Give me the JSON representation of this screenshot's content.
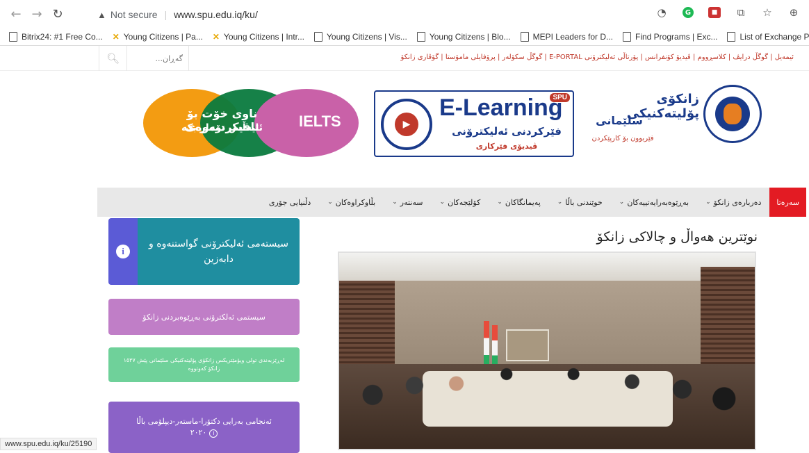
{
  "browser": {
    "insecure_label": "Not secure",
    "url": "www.spu.edu.iq/ku/",
    "bookmarks": [
      {
        "label": "Bitrix24: #1 Free Co...",
        "icon": "page-icon"
      },
      {
        "label": "Young Citizens | Pa...",
        "icon": "x-logo-icon"
      },
      {
        "label": "Young Citizens | Intr...",
        "icon": "x-logo-icon"
      },
      {
        "label": "Young Citizens | Vis...",
        "icon": "page-icon"
      },
      {
        "label": "Young Citizens | Blo...",
        "icon": "page-icon"
      },
      {
        "label": "MEPI Leaders for D...",
        "icon": "page-icon"
      },
      {
        "label": "Find Programs | Exc...",
        "icon": "page-icon"
      },
      {
        "label": "List of Exchange Pr...",
        "icon": "page-icon"
      }
    ],
    "status_url": "www.spu.edu.iq/ku/25190"
  },
  "topstrip": {
    "search_placeholder": "گەڕان...",
    "links": "ئیمەیل | گوگڵ درایڤ | کلاسڕووم | ڤیدیۆ کۆنفرانس | پۆرتاڵی ئەلیکترۆنی E-PORTAL | گوگڵ سکۆلەر | پرۆفایلی مامۆستا | گۆڤاری زانکۆ"
  },
  "banner": {
    "ielts_main": "ناوی خۆت بۆ تاقیکردنەوەی",
    "ielts_sub": "ئایەڵس تۆمار بکە",
    "ielts_word": "IELTS",
    "elearn_title": "E-Learning",
    "elearn_badge": "SPU",
    "elearn_sub": "فێرکردنی ئەلیکترۆنی",
    "elearn_sub2": "ڤیدیۆی فێرکاری",
    "univ_name": "زانکۆی پۆلیتەکنیکی",
    "univ_city": "سلێمانی",
    "univ_tag": "فێربوون بۆ کارپێکردن"
  },
  "nav": {
    "items": [
      {
        "label": "سەرەتا",
        "dropdown": false
      },
      {
        "label": "دەربارەی زانکۆ",
        "dropdown": true
      },
      {
        "label": "بەڕێوەبەرایەتییەکان",
        "dropdown": true
      },
      {
        "label": "خوێندنی باڵا",
        "dropdown": true
      },
      {
        "label": "پەیمانگاکان",
        "dropdown": true
      },
      {
        "label": "کۆلێجەکان",
        "dropdown": true
      },
      {
        "label": "سەنتەر",
        "dropdown": true
      },
      {
        "label": "بڵاوکراوەکان",
        "dropdown": true
      },
      {
        "label": "دڵنیایی جۆری",
        "dropdown": false
      }
    ]
  },
  "sidebar": {
    "info_card": "سیستەمی ئەلیکترۆنی گواستنەوە و دابەزین",
    "pink_card": "سیستمی ئەلکترۆنی بەڕێوەبردنی زانکۆ",
    "green_card": "لەڕێزبەندی تولی ویۆمێتریکس زانکۆی پۆلیتەکنیکی سلێمانی پێش ١٥٣٧ زانکۆ کەوتووە",
    "purple_card_line1": "ئەنجامی بەرایی دکتۆرا-ماستەر-دیپلۆمی باڵا",
    "purple_card_line2": "٢٠٢٠"
  },
  "main": {
    "news_title": "نوێترین هەواڵ و چالاکی زانکۆ"
  }
}
